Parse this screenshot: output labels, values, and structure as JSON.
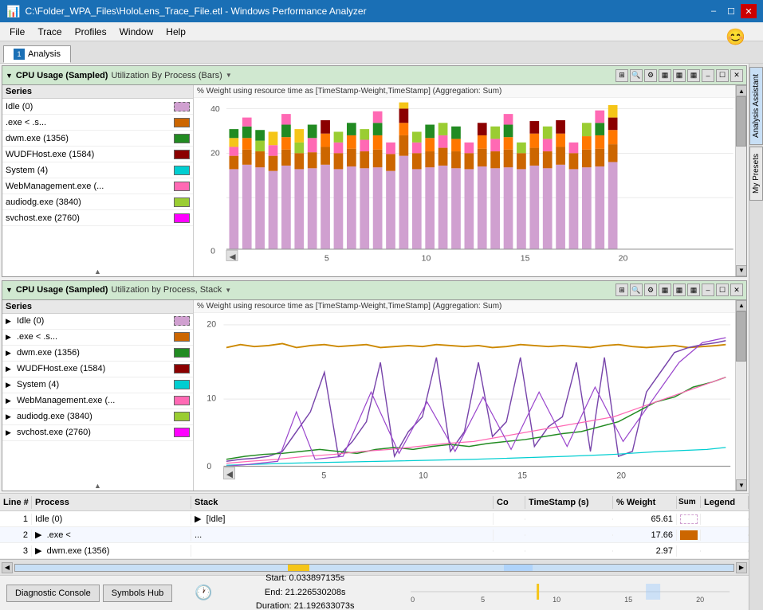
{
  "titlebar": {
    "title": "C:\\Folder_WPA_Files\\HoloLens_Trace_File.etl - Windows Performance Analyzer",
    "minimize": "–",
    "maximize": "☐",
    "close": "✕"
  },
  "menubar": {
    "items": [
      "File",
      "Trace",
      "Profiles",
      "Window",
      "Help"
    ]
  },
  "tabs": [
    {
      "num": "1",
      "label": "Analysis"
    }
  ],
  "panel1": {
    "title": "CPU Usage (Sampled)",
    "subtitle": "Utilization By Process (Bars)",
    "chart_title": "% Weight using resource time as [TimeStamp-Weight,TimeStamp] (Aggregation: Sum)",
    "series": [
      {
        "label": "Series",
        "is_header": true
      },
      {
        "label": "Idle (0)",
        "color": "#d0a0d0",
        "expandable": false
      },
      {
        "label": ".exe <        .s...",
        "color": "#cc6600",
        "expandable": false
      },
      {
        "label": "dwm.exe (1356)",
        "color": "#228b22",
        "expandable": false
      },
      {
        "label": "WUDFHost.exe (1584)",
        "color": "#8b0000",
        "expandable": false
      },
      {
        "label": "System (4)",
        "color": "#00ced1",
        "expandable": false
      },
      {
        "label": "WebManagement.exe (...",
        "color": "#ff69b4",
        "expandable": false
      },
      {
        "label": "audiodg.exe (3840)",
        "color": "#9acd32",
        "expandable": false
      },
      {
        "label": "svchost.exe (2760)",
        "color": "#ff00ff",
        "expandable": false
      }
    ],
    "y_max": 40,
    "x_labels": [
      "0",
      "5",
      "10",
      "15",
      "20"
    ]
  },
  "panel2": {
    "title": "CPU Usage (Sampled)",
    "subtitle": "Utilization by Process, Stack",
    "chart_title": "% Weight using resource time as [TimeStamp-Weight,TimeStamp] (Aggregation: Sum)",
    "series": [
      {
        "label": "Series",
        "is_header": true
      },
      {
        "label": "Idle (0)",
        "color": "#d0a0d0",
        "expandable": true
      },
      {
        "label": ".exe <        .s...",
        "color": "#cc6600",
        "expandable": true
      },
      {
        "label": "dwm.exe (1356)",
        "color": "#228b22",
        "expandable": true
      },
      {
        "label": "WUDFHost.exe (1584)",
        "color": "#8b0000",
        "expandable": true
      },
      {
        "label": "System (4)",
        "color": "#00ced1",
        "expandable": true
      },
      {
        "label": "WebManagement.exe (...",
        "color": "#ff69b4",
        "expandable": true
      },
      {
        "label": "audiodg.exe (3840)",
        "color": "#9acd32",
        "expandable": true
      },
      {
        "label": "svchost.exe (2760)",
        "color": "#ff00ff",
        "expandable": true
      }
    ],
    "y_max": 20,
    "x_labels": [
      "0",
      "5",
      "10",
      "15",
      "20"
    ]
  },
  "datatable": {
    "columns": [
      "Line #",
      "Process",
      "Stack",
      "Co",
      "TimeStamp (s)",
      "% Weight",
      "Sum",
      "Legend"
    ],
    "rows": [
      {
        "line": "1",
        "process": "Idle (0)",
        "stack": "▶  [Idle]",
        "co": "",
        "timestamp": "",
        "weight": "65.61",
        "color": "#d0a0d0"
      },
      {
        "line": "2",
        "process": "▶  .exe <",
        "stack": "...",
        "co": "",
        "timestamp": "",
        "weight": "17.66",
        "color": "#cc6600"
      },
      {
        "line": "3",
        "process": "▶  dwm.exe (1356)",
        "stack": "",
        "co": "",
        "timestamp": "",
        "weight": "2.97",
        "color": "#228b22"
      }
    ]
  },
  "timeline": {
    "start": "Start:  0.033897135s",
    "end": "End:  21.226530208s",
    "duration": "Duration:  21.192633073s"
  },
  "footer": {
    "btn1": "Diagnostic Console",
    "btn2": "Symbols Hub"
  },
  "sidebar": {
    "tab1": "Analysis Assistant",
    "tab2": "My Presets"
  },
  "colors": {
    "idle": "#d0a0d0",
    "exe": "#cc6600",
    "dwm": "#228b22",
    "wudf": "#8b0000",
    "system_teal": "#00ced1",
    "webmgmt": "#ff69b4",
    "audiodg": "#9acd32",
    "svchost": "#ff00ff",
    "bar_yellow": "#f5c518",
    "bar_orange": "#ff7700",
    "bar_red": "#cc2200",
    "bar_green_dark": "#228b22",
    "panel_header_bg": "#d0e8d0"
  }
}
